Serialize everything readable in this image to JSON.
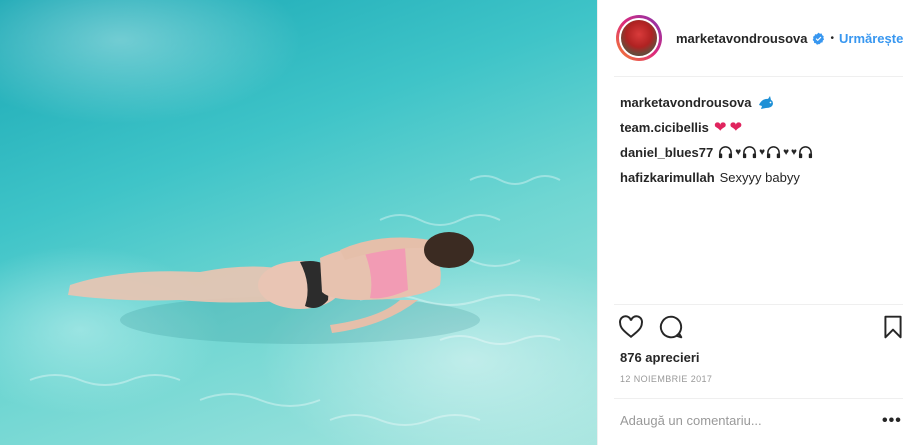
{
  "post": {
    "username": "marketavondrousova",
    "follow_label": "Urmărește",
    "separator": "•"
  },
  "comments": [
    {
      "user": "marketavondrousova",
      "text": "",
      "emoji": "dolphin"
    },
    {
      "user": "team.cicibellis",
      "text": "",
      "emoji": "hearts"
    },
    {
      "user": "daniel_blues77",
      "text": "",
      "emoji": "headphones"
    },
    {
      "user": "hafizkarimullah",
      "text": "Sexyyy babyy"
    }
  ],
  "likes_label": "876 aprecieri",
  "date_label": "12 NOIEMBRIE 2017",
  "comment_input": {
    "placeholder": "Adaugă un comentariu..."
  },
  "more_label": "•••",
  "colors": {
    "accent": "#3897f0",
    "heart": "#e0245e",
    "text": "#262626",
    "muted": "#999999"
  }
}
